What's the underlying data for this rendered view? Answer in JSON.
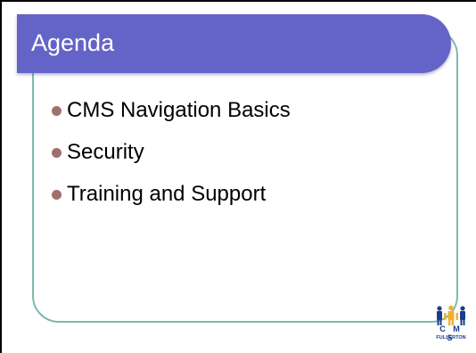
{
  "slide": {
    "title": "Agenda",
    "items": [
      {
        "label": "CMS Navigation Basics"
      },
      {
        "label": "Security"
      },
      {
        "label": "Training and Support"
      }
    ]
  },
  "logo": {
    "icon": "cms-fullerton-logo",
    "text_top": "C M S",
    "text_bottom": "FULLERTON"
  },
  "colors": {
    "title_bar": "#6464c8",
    "frame": "#7fb7b0",
    "bullet": "#a0706e",
    "logo_blue": "#1a3c8c",
    "logo_gold": "#f0b030"
  }
}
